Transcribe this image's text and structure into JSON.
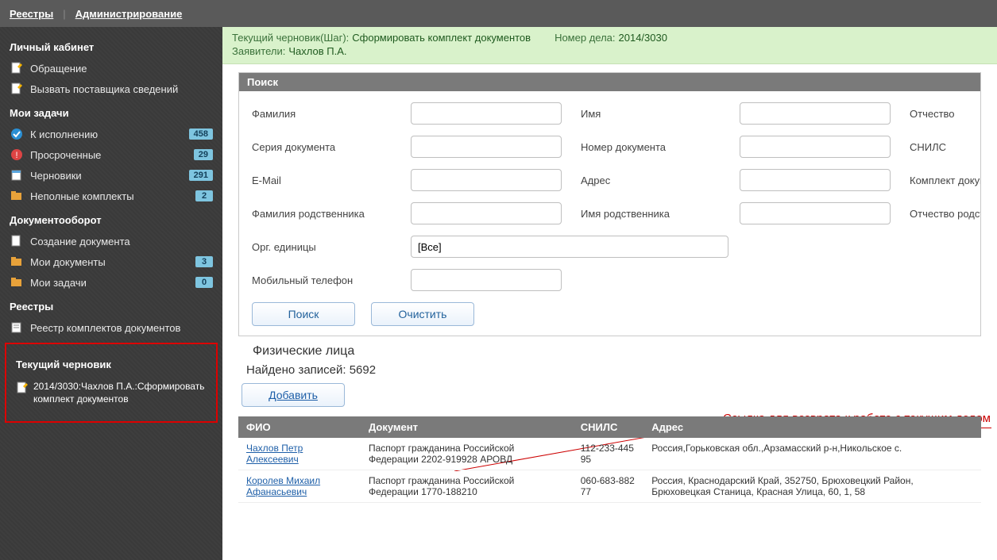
{
  "topnav": {
    "registries": "Реестры",
    "admin": "Администрирование"
  },
  "sidebar": {
    "cabinet_title": "Личный кабинет",
    "cabinet_items": [
      {
        "label": "Обращение"
      },
      {
        "label": "Вызвать поставщика сведений"
      }
    ],
    "tasks_title": "Мои задачи",
    "tasks_items": [
      {
        "label": "К исполнению",
        "badge": "458"
      },
      {
        "label": "Просроченные",
        "badge": "29"
      },
      {
        "label": "Черновики",
        "badge": "291"
      },
      {
        "label": "Неполные комплекты",
        "badge": "2"
      }
    ],
    "docflow_title": "Документооборот",
    "docflow_items": [
      {
        "label": "Создание документа",
        "badge": ""
      },
      {
        "label": "Мои документы",
        "badge": "3"
      },
      {
        "label": "Мои задачи",
        "badge": "0"
      }
    ],
    "registries_title": "Реестры",
    "registries_items": [
      {
        "label": "Реестр комплектов документов"
      }
    ],
    "draft_title": "Текущий черновик",
    "draft_item": "2014/3030:Чахлов П.А.:Сформировать комплект документов"
  },
  "caseinfo": {
    "step_lbl": "Текущий черновик(Шаг):",
    "step_val": "Сформировать комплект документов",
    "num_lbl": "Номер дела:",
    "num_val": "2014/3030",
    "appl_lbl": "Заявители:",
    "appl_val": "Чахлов П.А."
  },
  "search": {
    "panel_title": "Поиск",
    "labels": {
      "surname": "Фамилия",
      "name": "Имя",
      "patronymic": "Отчество",
      "doc_series": "Серия документа",
      "doc_number": "Номер документа",
      "snils": "СНИЛС",
      "email": "E-Mail",
      "address": "Адрес",
      "komplekt": "Комплект докум",
      "rel_surname": "Фамилия родственника",
      "rel_name": "Имя родственника",
      "rel_patronymic": "Отчество родст",
      "org_units": "Орг. единицы",
      "org_units_val": "[Все]",
      "phone": "Мобильный телефон"
    },
    "buttons": {
      "search": "Поиск",
      "clear": "Очистить"
    }
  },
  "results": {
    "title": "Физические лица",
    "count_label": "Найдено записей: 5692",
    "add_btn": "Добавить",
    "columns": {
      "fio": "ФИО",
      "doc": "Документ",
      "snils": "СНИЛС",
      "addr": "Адрес"
    },
    "rows": [
      {
        "fio": "Чахлов Петр Алексеевич",
        "doc": "Паспорт гражданина Российской Федерации 2202-919928 АРОВД",
        "snils": "112-233-445 95",
        "addr": "Россия,Горьковская обл.,Арзамасский р-н,Никольское с."
      },
      {
        "fio": "Королев Михаил Афанасьевич",
        "doc": "Паспорт гражданина Российской Федерации 1770-188210",
        "snils": "060-683-882 77",
        "addr": "Россия, Краснодарский Край, 352750, Брюховецкий Район, Брюховецкая Станица, Красная Улица, 60, 1, 58"
      }
    ]
  },
  "annotation": "Ссылка для возврата к работе с текущим делом"
}
